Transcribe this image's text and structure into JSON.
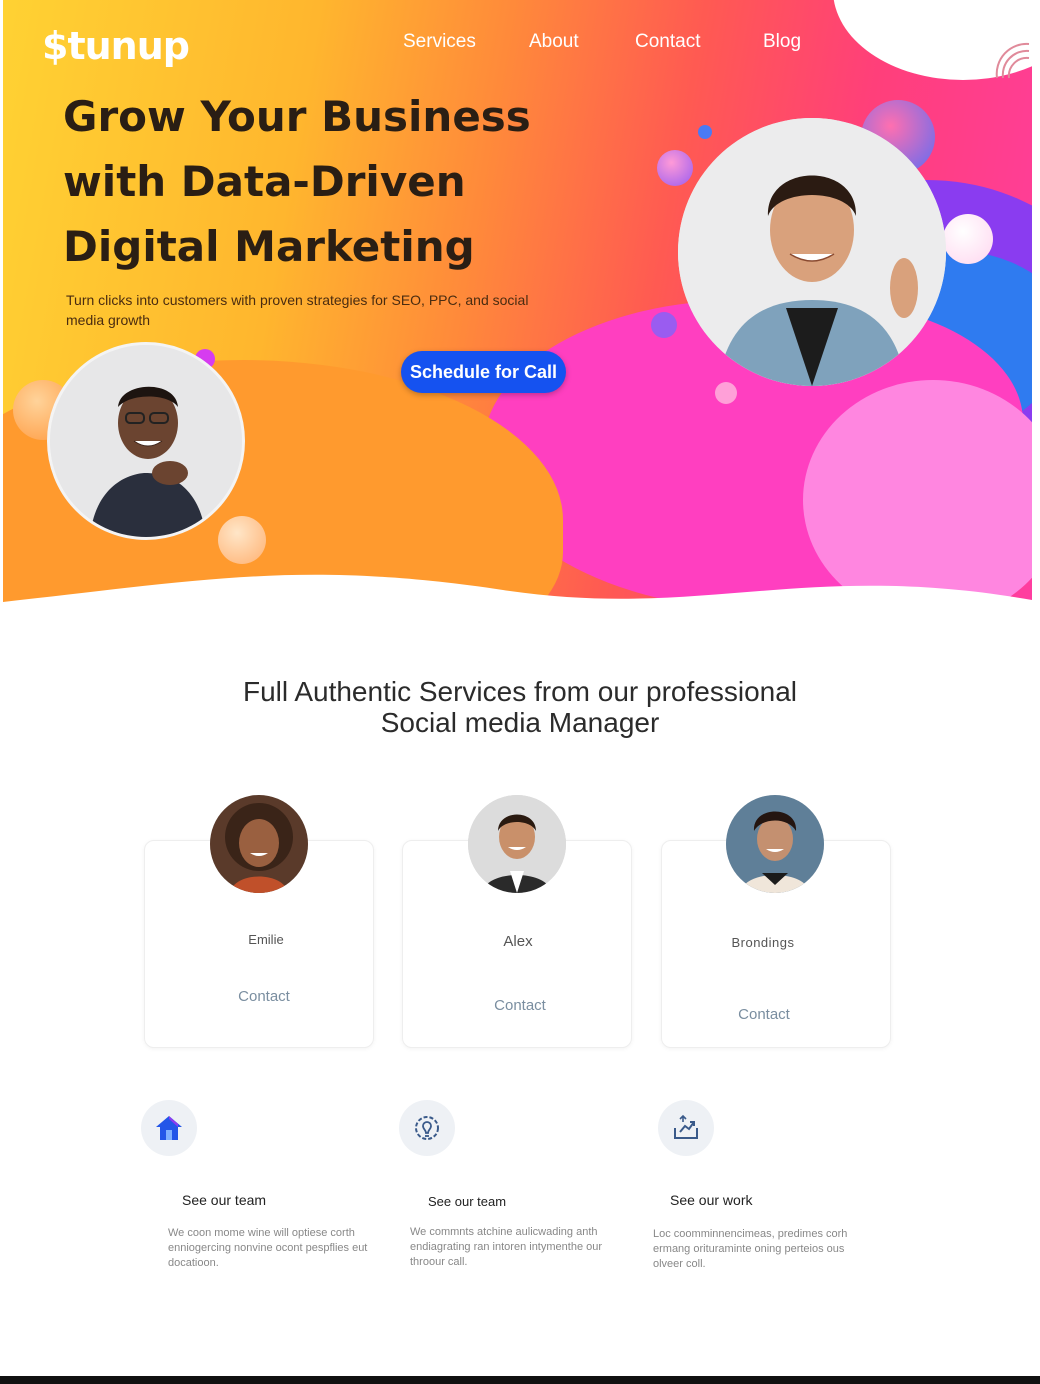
{
  "nav": {
    "logo": "$tunup",
    "links": [
      "Services",
      "About",
      "Contact",
      "Blog"
    ]
  },
  "hero": {
    "title_lines": [
      "Grow Your Business",
      "with Data-Driven",
      "Digital Marketing"
    ],
    "subtitle": "Turn clicks into customers with proven strategies for SEO, PPC, and social media growth",
    "cta_label": "Schedule for Call"
  },
  "services_section": {
    "title_line1": "Full Authentic Services from our professional",
    "title_line2": "Social media Manager"
  },
  "team": [
    {
      "name": "Emilie",
      "contact_label": "Contact"
    },
    {
      "name": "Alex",
      "contact_label": "Contact"
    },
    {
      "name": "Brondings",
      "contact_label": "Contact"
    }
  ],
  "features": [
    {
      "icon": "house-icon",
      "title": "See our team",
      "text": "We coon mome wine will optiese corth enniogercing nonvine ocont pespflies eut docatioon."
    },
    {
      "icon": "lightbulb-gear-icon",
      "title": "See our team",
      "text": "We commnts atchine aulicwading anth endiagrating ran intoren intymenthe our throour call."
    },
    {
      "icon": "chart-upload-icon",
      "title": "See our work",
      "text": "Loc coomminnencimeas, predimes corh ermang orituraminte oning perteios ous olveer coll."
    }
  ],
  "colors": {
    "accent": "#1552f0",
    "hero_yellow": "#ffd233",
    "hero_pink": "#ff3da0",
    "hero_blue": "#2f7bf0"
  }
}
